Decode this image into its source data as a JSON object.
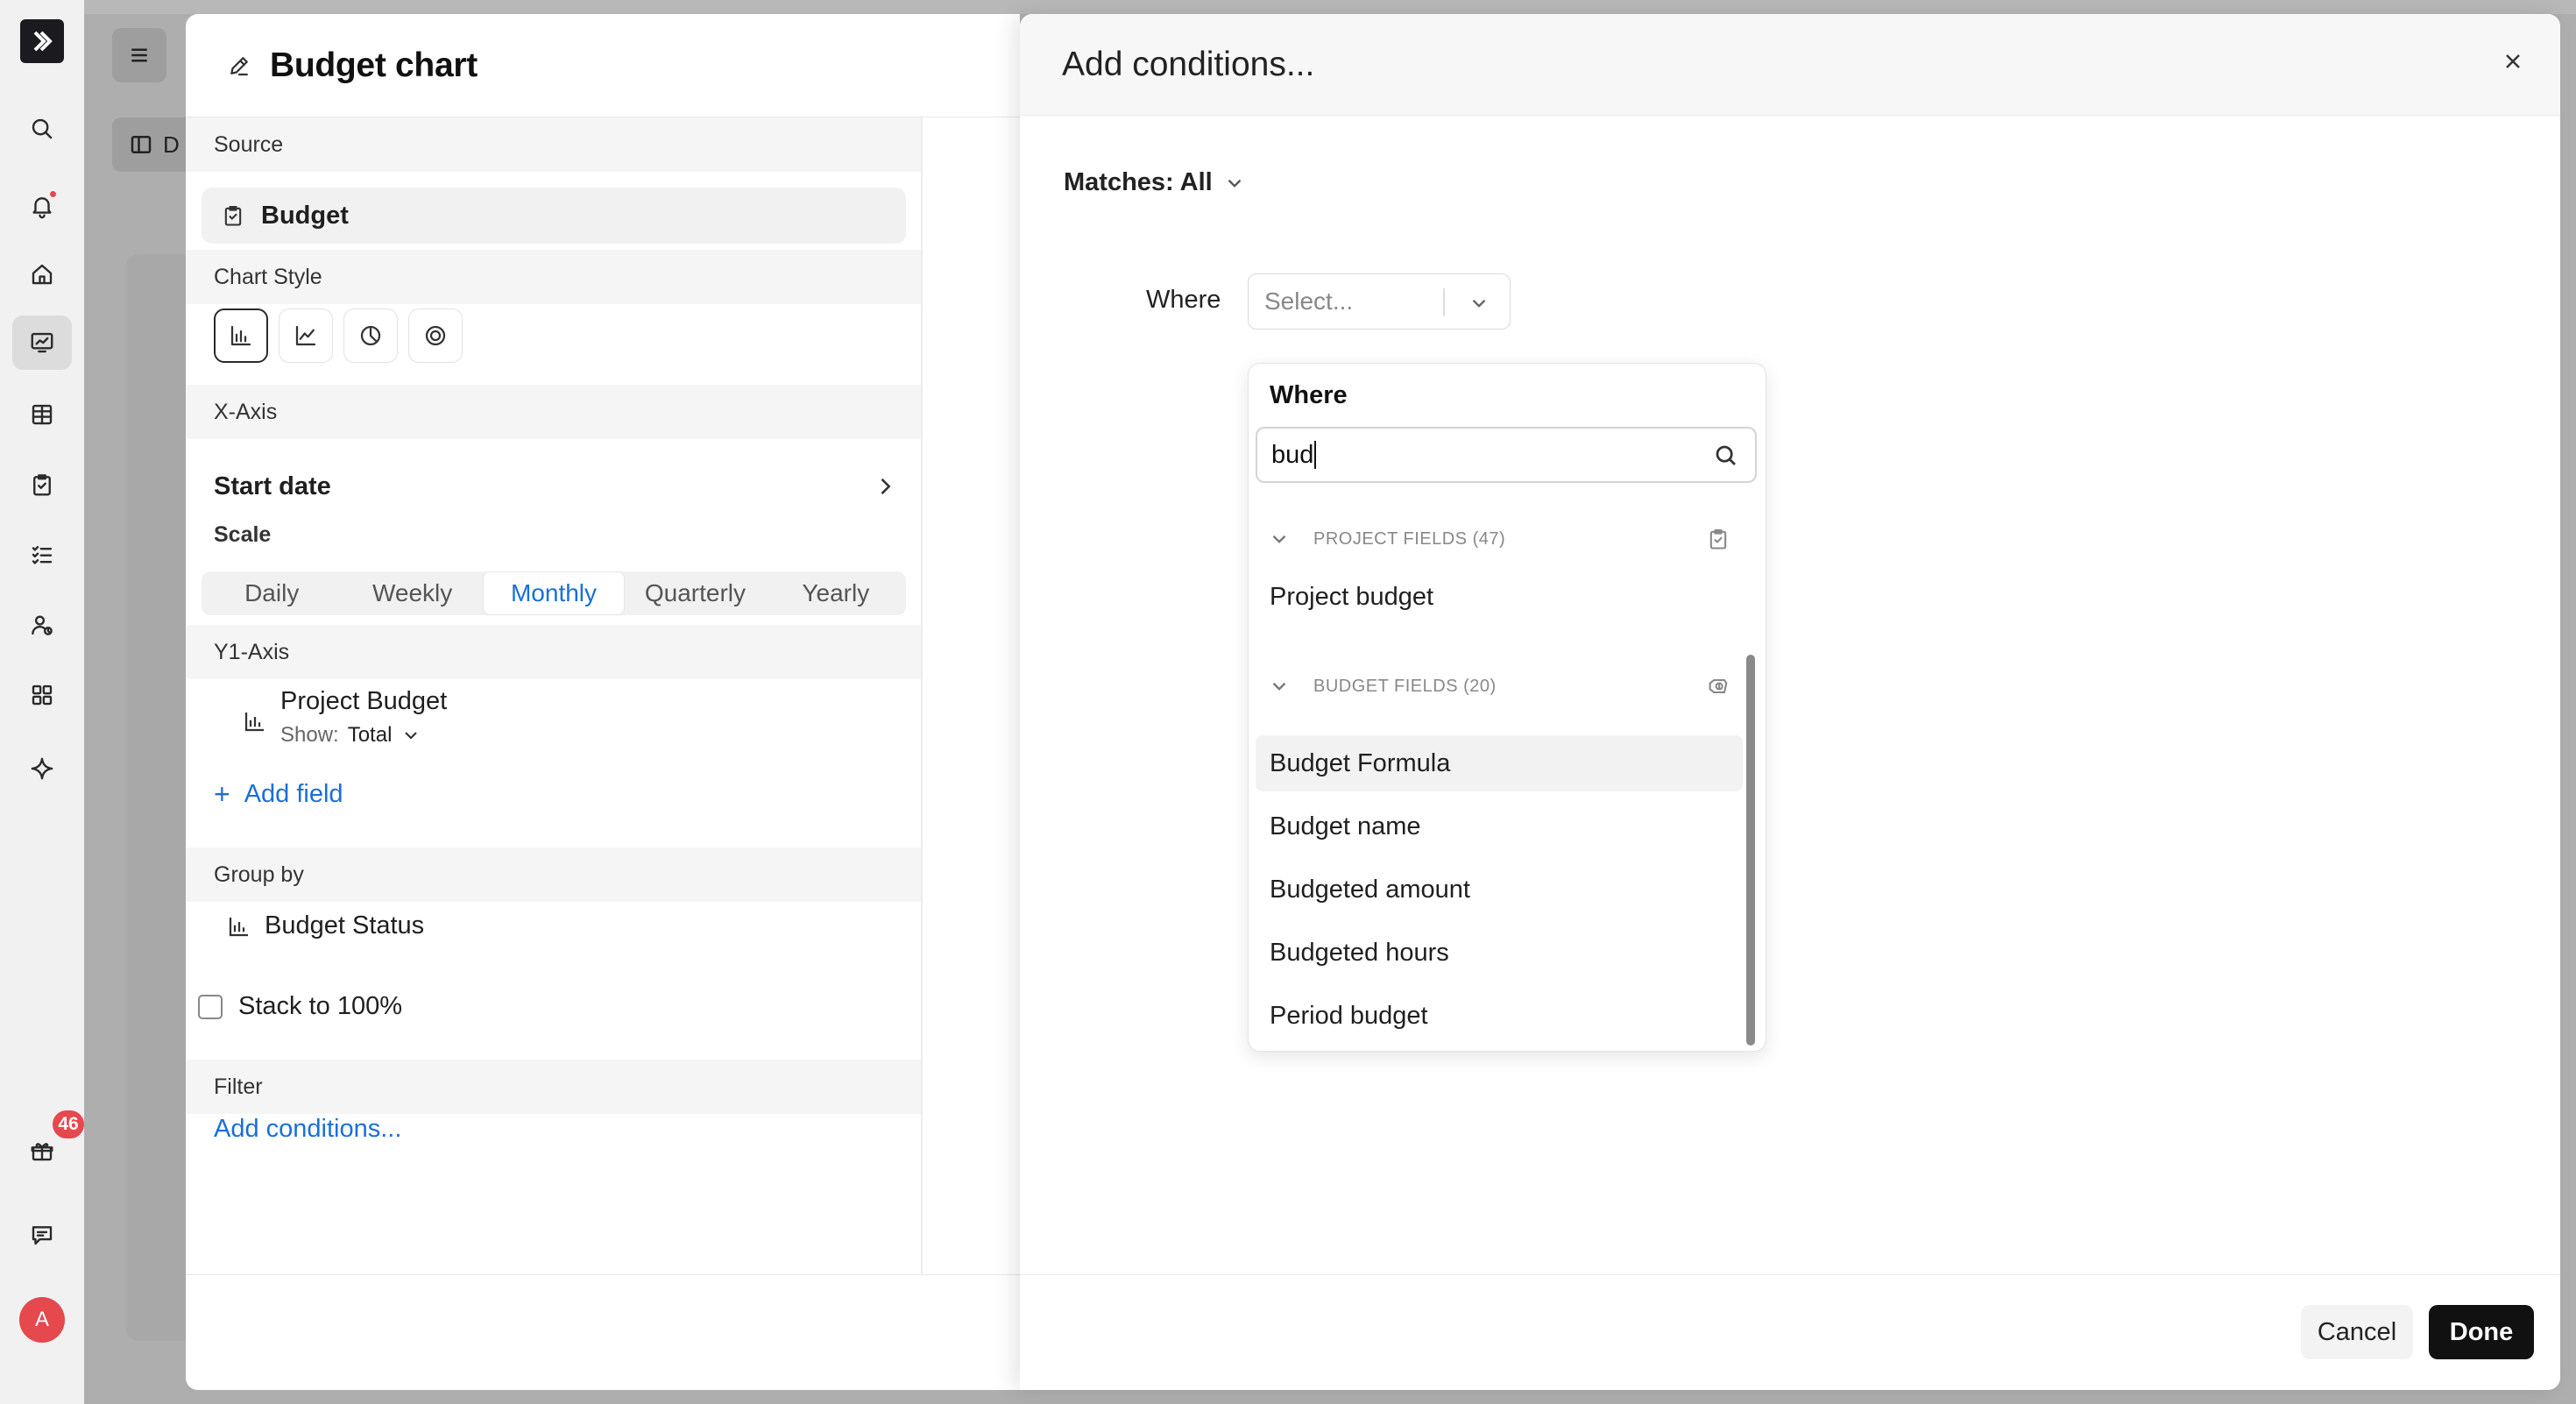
{
  "rail": {
    "badge_count": "46",
    "avatar_initial": "A",
    "icons": [
      "logo-icon",
      "search-icon",
      "bell-icon",
      "home-icon",
      "dashboard-icon",
      "projects-icon",
      "tasks-icon",
      "checklist-icon",
      "people-icon",
      "apps-icon",
      "sparkle-icon",
      "gift-icon",
      "chat-icon"
    ]
  },
  "background": {
    "tab_label": "D"
  },
  "editor": {
    "title": "Budget chart",
    "sections": {
      "source": "Source",
      "chart_style": "Chart Style",
      "x_axis": "X-Axis",
      "y1_axis": "Y1-Axis",
      "group_by": "Group by",
      "filter": "Filter"
    },
    "source_value": "Budget",
    "chart_styles": [
      "bar-chart-icon",
      "line-chart-icon",
      "pie-chart-icon",
      "donut-chart-icon"
    ],
    "x_axis_field": "Start date",
    "scale_label": "Scale",
    "scale_options": [
      "Daily",
      "Weekly",
      "Monthly",
      "Quarterly",
      "Yearly"
    ],
    "scale_selected": "Monthly",
    "y_field": {
      "name": "Project Budget",
      "show_label": "Show:",
      "show_value": "Total"
    },
    "add_field": "Add field",
    "group_field": "Budget Status",
    "stack_label": "Stack to 100%",
    "stack_checked": false,
    "add_conditions": "Add conditions..."
  },
  "conditions": {
    "title": "Add conditions...",
    "matches_label": "Matches: All",
    "where_label": "Where",
    "select_placeholder": "Select...",
    "dropdown": {
      "title": "Where",
      "search_value": "bud",
      "groups": [
        {
          "label": "PROJECT FIELDS (47)",
          "icon": "clipboard-icon",
          "items": [
            "Project budget"
          ]
        },
        {
          "label": "BUDGET FIELDS (20)",
          "icon": "budget-icon",
          "items": [
            "Budget Formula",
            "Budget name",
            "Budgeted amount",
            "Budgeted hours",
            "Period budget"
          ]
        }
      ],
      "highlighted": "Budget Formula"
    },
    "cancel_label": "Cancel",
    "done_label": "Done"
  }
}
